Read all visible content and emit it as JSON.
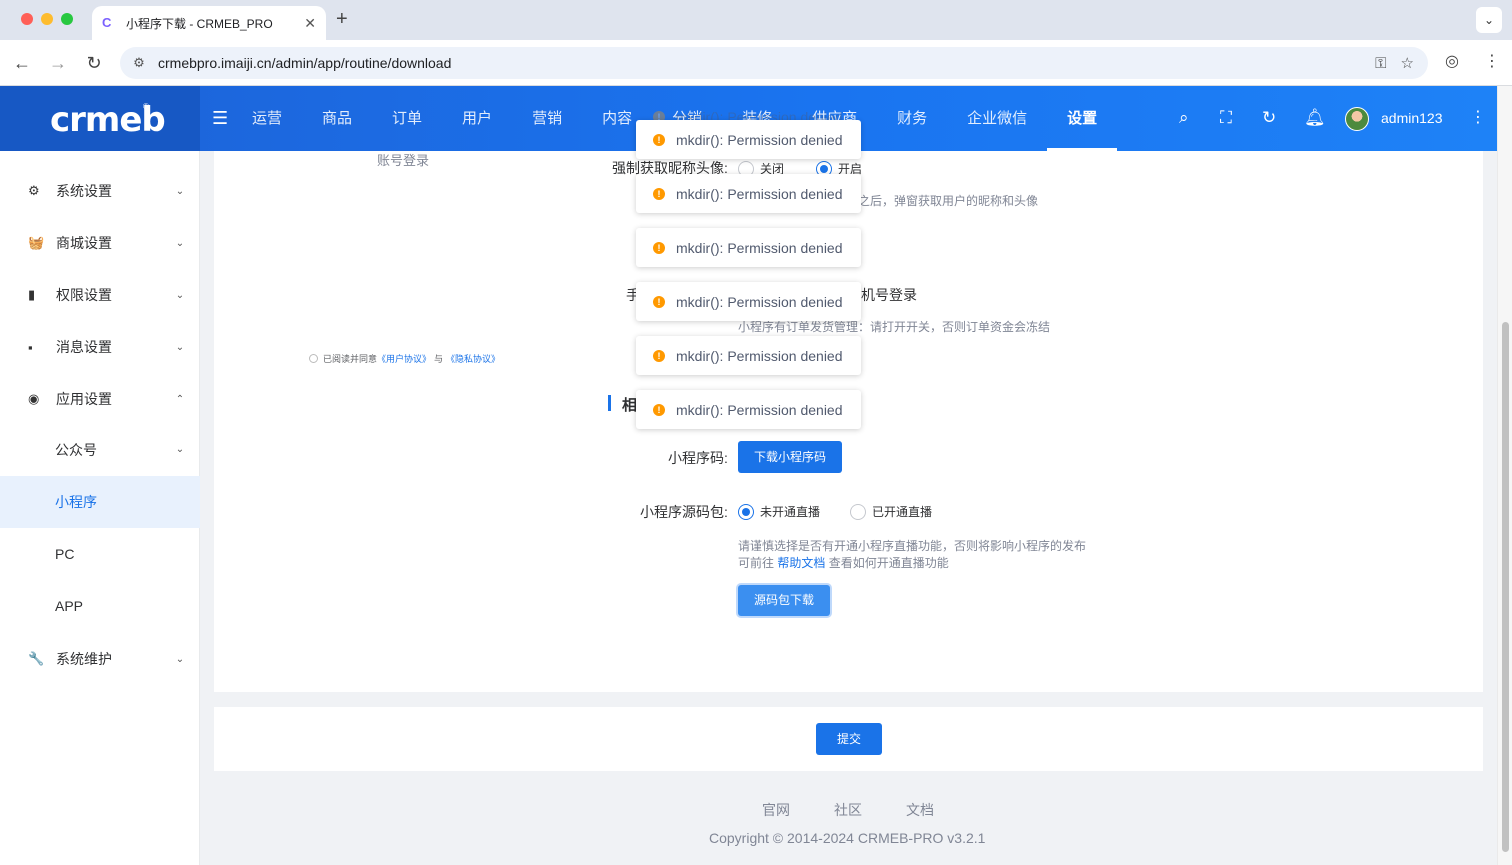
{
  "browser": {
    "tab_title": "小程序下载 - CRMEB_PRO",
    "tab_favicon": "C",
    "url": "crmebpro.imaiji.cn/admin/app/routine/download"
  },
  "header": {
    "logo": "crmeb",
    "logo_mark": "®",
    "nav": [
      "运营",
      "商品",
      "订单",
      "用户",
      "营销",
      "内容",
      "分销",
      "装修",
      "供应商",
      "财务",
      "企业微信",
      "设置"
    ],
    "active_nav": "设置",
    "username": "admin123"
  },
  "sidebar": {
    "groups": [
      {
        "label": "系统设置",
        "icon": "gear-icon",
        "glyph": "⚙",
        "arrow": "⌄"
      },
      {
        "label": "商城设置",
        "icon": "basket-icon",
        "glyph": "🧺",
        "arrow": "⌄"
      },
      {
        "label": "权限设置",
        "icon": "bookmark-icon",
        "glyph": "▮",
        "arrow": "⌄"
      },
      {
        "label": "消息设置",
        "icon": "message-icon",
        "glyph": "▪",
        "arrow": "⌄"
      },
      {
        "label": "应用设置",
        "icon": "app-icon",
        "glyph": "◉",
        "arrow": "⌃"
      }
    ],
    "subitems": [
      {
        "label": "公众号",
        "arrow": "⌄"
      },
      {
        "label": "小程序"
      },
      {
        "label": "PC"
      },
      {
        "label": "APP"
      }
    ],
    "maintenance": {
      "label": "系统维护",
      "glyph": "🔧",
      "arrow": "⌄"
    }
  },
  "form": {
    "account_login_faint": "账号登录",
    "force_avatar_label": "强制获取昵称头像:",
    "force_avatar_off": "关闭",
    "force_avatar_on": "开启",
    "force_avatar_hint": "之后，弹窗获取用户的昵称和头像",
    "phone_login_prefix": "手",
    "phone_login_suffix": "机号登录",
    "shipping_hint": "小程序有订单发货管理：请打开开关，否则订单资金会冻结",
    "agree_prefix": "已阅读并同意",
    "agree_user": "《用户协议》",
    "agree_and": "与",
    "agree_privacy": "《隐私协议》",
    "section_title_char": "相",
    "qrcode_label": "小程序码:",
    "qrcode_button": "下载小程序码",
    "source_label": "小程序源码包:",
    "source_opt_no": "未开通直播",
    "source_opt_yes": "已开通直播",
    "source_hint_1": "请谨慎选择是否有开通小程序直播功能，否则将影响小程序的发布",
    "source_hint_2_prefix": "可前往",
    "source_hint_2_link": "帮助文档",
    "source_hint_2_suffix": "查看如何开通直播功能",
    "source_button": "源码包下载",
    "submit_button": "提交"
  },
  "toasts": [
    "mkdir(): Permission denied",
    "mkdir(): Permission denied",
    "mkdir(): Permission denied",
    "mkdir(): Permission denied",
    "mkdir(): Permission denied",
    "mkdir(): Permission denied",
    "mkdir(): Permission denied"
  ],
  "footer": {
    "links": [
      "官网",
      "社区",
      "文档"
    ],
    "copyright": "Copyright © 2014-2024 CRMEB-PRO v3.2.1"
  },
  "colors": {
    "primary": "#1a73e8",
    "warning": "#ff9900",
    "header_gradient_start": "#1d62d6",
    "header_gradient_end": "#1e82f7"
  }
}
